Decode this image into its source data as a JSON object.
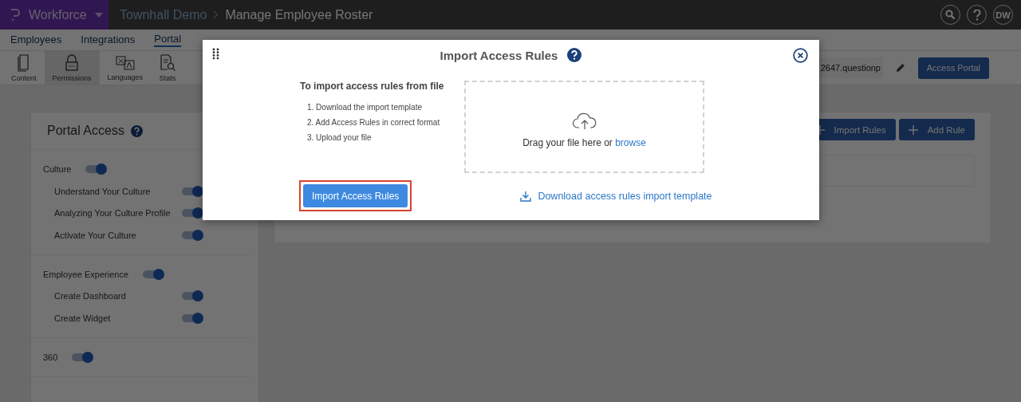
{
  "app": {
    "name": "Workforce"
  },
  "breadcrumb": [
    "Townhall Demo",
    "Manage Employee Roster"
  ],
  "header": {
    "avatar": "DW"
  },
  "nav_tabs": [
    {
      "label": "Employees",
      "selected": false
    },
    {
      "label": "Integrations",
      "selected": false
    },
    {
      "label": "Portal",
      "selected": true
    }
  ],
  "toolbar": [
    {
      "label": "Content",
      "kind": "page",
      "selected": false
    },
    {
      "label": "Permissions",
      "kind": "lock",
      "selected": true
    },
    {
      "label": "Languages",
      "kind": "translate",
      "selected": false
    },
    {
      "label": "Stats",
      "kind": "stats",
      "selected": false
    }
  ],
  "portal_url": {
    "value": "2647.questionp"
  },
  "access_button": "Access Portal",
  "portal_access": {
    "title": "Portal Access",
    "groups": [
      {
        "label": "Culture",
        "on": true,
        "children": [
          {
            "label": "Understand Your Culture",
            "on": true
          },
          {
            "label": "Analyzing Your Culture Profile",
            "on": true
          },
          {
            "label": "Activate Your Culture",
            "on": true
          }
        ]
      },
      {
        "label": "Employee Experience",
        "on": true,
        "children": [
          {
            "label": "Create Dashboard",
            "on": true
          },
          {
            "label": "Create Widget",
            "on": true
          }
        ]
      },
      {
        "label": "360",
        "on": true
      }
    ]
  },
  "rules_panel": {
    "buttons": [
      "Import Rules",
      "Add Rule"
    ]
  },
  "modal": {
    "title": "Import Access Rules",
    "intro": "To import access rules from file",
    "steps": [
      "1. Download the import template",
      "2. Add Access Rules in correct format",
      "3. Upload your file"
    ],
    "drop_text": "Drag your file here or",
    "browse": "browse",
    "import_button": {
      "label": "Import Access Rules",
      "highlighted": true
    },
    "template_link": "Download access rules import template"
  }
}
